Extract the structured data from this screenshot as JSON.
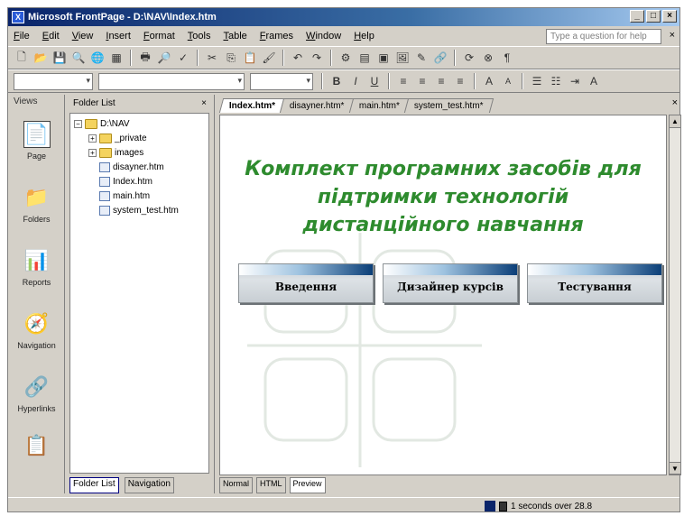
{
  "window": {
    "title": "Microsoft FrontPage - D:\\NAV\\Index.htm",
    "min": "_",
    "max": "□",
    "close": "×"
  },
  "menu": {
    "items": [
      "File",
      "Edit",
      "View",
      "Insert",
      "Format",
      "Tools",
      "Table",
      "Frames",
      "Window",
      "Help"
    ],
    "help_placeholder": "Type a question for help",
    "close": "×"
  },
  "views_pane": {
    "header": "Views",
    "items": [
      {
        "label": "Page",
        "icon": "page-view-icon"
      },
      {
        "label": "Folders",
        "icon": "folders-view-icon"
      },
      {
        "label": "Reports",
        "icon": "reports-view-icon"
      },
      {
        "label": "Navigation",
        "icon": "navigation-view-icon"
      },
      {
        "label": "Hyperlinks",
        "icon": "hyperlinks-view-icon"
      }
    ]
  },
  "folder_list": {
    "header": "Folder List",
    "close": "×",
    "nodes": [
      {
        "label": "D:\\NAV",
        "type": "folder",
        "level": 0,
        "expander": "−"
      },
      {
        "label": "_private",
        "type": "folder",
        "level": 1,
        "expander": "+"
      },
      {
        "label": "images",
        "type": "folder",
        "level": 1,
        "expander": "+"
      },
      {
        "label": "disayner.htm",
        "type": "file",
        "level": 1
      },
      {
        "label": "Index.htm",
        "type": "file",
        "level": 1
      },
      {
        "label": "main.htm",
        "type": "file",
        "level": 1
      },
      {
        "label": "system_test.htm",
        "type": "file",
        "level": 1
      }
    ],
    "tabs": [
      "Folder List",
      "Navigation"
    ]
  },
  "editor": {
    "tabs": [
      "Index.htm*",
      "disayner.htm*",
      "main.htm*",
      "system_test.htm*"
    ],
    "close": "×",
    "headline_lines": [
      "Комплект програмних засобів для",
      "підтримки технологій",
      "дистанційного навчання"
    ],
    "buttons": [
      "Введення",
      "Дизайнер курсів",
      "Тестування"
    ],
    "view_tabs": [
      "Normal",
      "HTML",
      "Preview"
    ]
  },
  "status": {
    "text": "1 seconds over 28.8"
  },
  "colors": {
    "headline": "#2e8b2e",
    "titlebar": "#0a246a",
    "chrome": "#d4d0c8"
  }
}
